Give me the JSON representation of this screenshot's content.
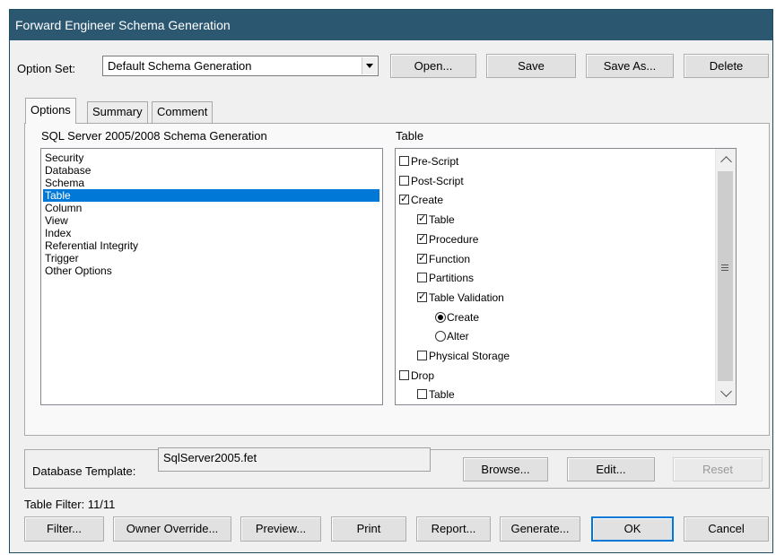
{
  "window": {
    "title": "Forward Engineer Schema Generation"
  },
  "option_set": {
    "label": "Option Set:",
    "value": "Default Schema Generation",
    "buttons": {
      "open": "Open...",
      "save": "Save",
      "save_as": "Save As...",
      "delete": "Delete"
    }
  },
  "tabs": [
    "Options",
    "Summary",
    "Comment"
  ],
  "left": {
    "heading": "SQL Server 2005/2008 Schema Generation",
    "items": [
      "Security",
      "Database",
      "Schema",
      "Table",
      "Column",
      "View",
      "Index",
      "Referential Integrity",
      "Trigger",
      "Other Options"
    ],
    "selected": "Table"
  },
  "right": {
    "heading": "Table",
    "options": [
      {
        "label": "Pre-Script",
        "type": "checkbox",
        "checked": false,
        "level": 0
      },
      {
        "label": "Post-Script",
        "type": "checkbox",
        "checked": false,
        "level": 0
      },
      {
        "label": "Create",
        "type": "checkbox",
        "checked": true,
        "level": 0
      },
      {
        "label": "Table",
        "type": "checkbox",
        "checked": true,
        "level": 1
      },
      {
        "label": "Procedure",
        "type": "checkbox",
        "checked": true,
        "level": 1
      },
      {
        "label": "Function",
        "type": "checkbox",
        "checked": true,
        "level": 1
      },
      {
        "label": "Partitions",
        "type": "checkbox",
        "checked": false,
        "level": 1
      },
      {
        "label": "Table Validation",
        "type": "checkbox",
        "checked": true,
        "level": 1
      },
      {
        "label": "Create",
        "type": "radio",
        "checked": true,
        "level": 2
      },
      {
        "label": "Alter",
        "type": "radio",
        "checked": false,
        "level": 2
      },
      {
        "label": "Physical Storage",
        "type": "checkbox",
        "checked": false,
        "level": 1
      },
      {
        "label": "Drop",
        "type": "checkbox",
        "checked": false,
        "level": 0
      },
      {
        "label": "Table",
        "type": "checkbox",
        "checked": false,
        "level": 1
      }
    ]
  },
  "template": {
    "label": "Database Template:",
    "value": "SqlServer2005.fet",
    "buttons": {
      "browse": "Browse...",
      "edit": "Edit...",
      "reset": "Reset"
    }
  },
  "table_filter": "Table Filter: 11/11",
  "bottom_buttons": {
    "filter": "Filter...",
    "owner_override": "Owner Override...",
    "preview": "Preview...",
    "print": "Print",
    "report": "Report...",
    "generate": "Generate...",
    "ok": "OK",
    "cancel": "Cancel"
  }
}
